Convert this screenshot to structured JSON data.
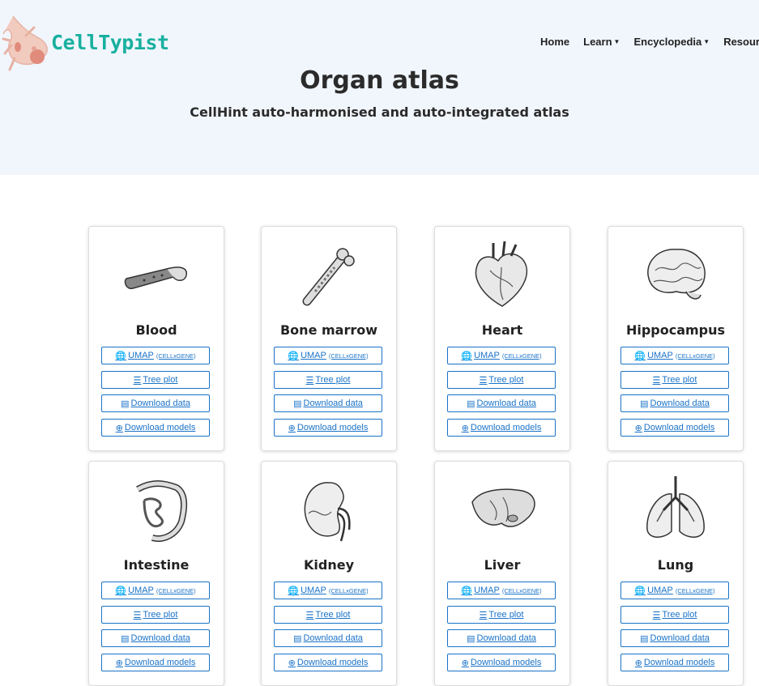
{
  "brand": {
    "name": "CellTypist"
  },
  "nav": {
    "items": [
      {
        "label": "Home",
        "dropdown": false
      },
      {
        "label": "Learn",
        "dropdown": true
      },
      {
        "label": "Encyclopedia",
        "dropdown": true
      },
      {
        "label": "Resources",
        "dropdown": false
      }
    ]
  },
  "hero": {
    "title": "Organ atlas",
    "subtitle": "CellHint auto-harmonised and auto-integrated atlas"
  },
  "buttons": {
    "umap": "UMAP",
    "umap_small": "(CELLxGENE)",
    "tree": "Tree plot",
    "data": "Download data",
    "models": "Download models"
  },
  "icons": {
    "umap": "globe-icon",
    "tree": "list-icon",
    "data": "file-download-icon",
    "models": "circle-download-icon"
  },
  "colors": {
    "brand": "#19b09f",
    "link": "#1a73c8",
    "hero_bg": "#f1f6fd"
  },
  "organs": [
    {
      "name": "Blood",
      "icon": "blood-vessel-icon"
    },
    {
      "name": "Bone marrow",
      "icon": "bone-icon"
    },
    {
      "name": "Heart",
      "icon": "heart-organ-icon"
    },
    {
      "name": "Hippocampus",
      "icon": "brain-icon"
    },
    {
      "name": "Intestine",
      "icon": "intestine-icon"
    },
    {
      "name": "Kidney",
      "icon": "kidney-icon"
    },
    {
      "name": "Liver",
      "icon": "liver-icon"
    },
    {
      "name": "Lung",
      "icon": "lung-icon"
    }
  ]
}
